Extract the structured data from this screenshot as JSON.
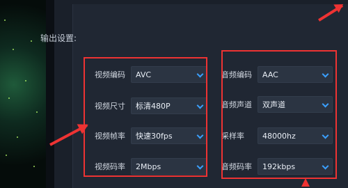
{
  "section": {
    "title": "输出设置:"
  },
  "video": {
    "codec": {
      "label": "视频编码",
      "value": "AVC",
      "icon": "chevron-down-icon"
    },
    "size": {
      "label": "视频尺寸",
      "value": "标清480P",
      "icon": "chevron-down-icon"
    },
    "framerate": {
      "label": "视频帧率",
      "value": "快速30fps",
      "icon": "chevron-down-icon"
    },
    "bitrate": {
      "label": "视频码率",
      "value": "2Mbps",
      "icon": "chevron-down-icon"
    }
  },
  "audio": {
    "codec": {
      "label": "音频编码",
      "value": "AAC",
      "icon": "chevron-down-icon"
    },
    "channels": {
      "label": "音频声道",
      "value": "双声道",
      "icon": "chevron-down-icon"
    },
    "samplerate": {
      "label": "采样率",
      "value": "48000hz",
      "icon": "chevron-down-icon"
    },
    "bitrate": {
      "label": "音频码率",
      "value": "192kbps",
      "icon": "chevron-down-icon"
    }
  },
  "colors": {
    "accent": "#3aa0ff",
    "highlight": "#e33333",
    "panel": "#202733",
    "field": "#2b3442"
  }
}
